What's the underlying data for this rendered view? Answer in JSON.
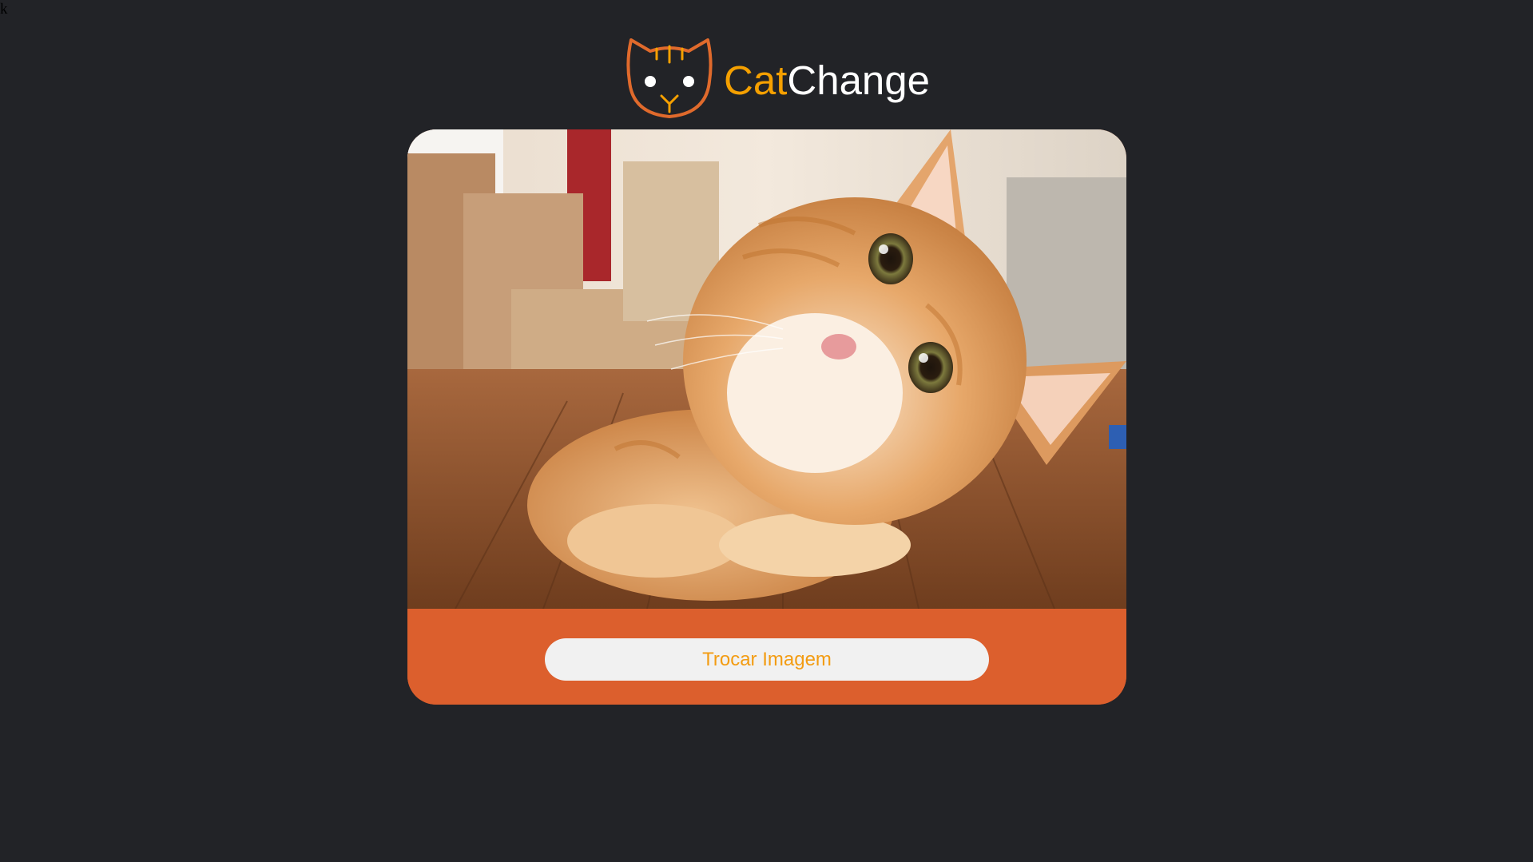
{
  "stray_text": "k",
  "brand": {
    "name_part1": "Cat",
    "name_part2": "Change",
    "icon": "cat-head-icon",
    "colors": {
      "accent_orange": "#f5a000",
      "outline_orange": "#e06a2c",
      "white": "#ffffff"
    }
  },
  "card": {
    "image": "orange-tabby-cat-photo",
    "button_label": "Trocar Imagem",
    "colors": {
      "footer_bg": "#dc5f2d",
      "button_bg": "#f1f1f1",
      "button_text": "#f39c12"
    }
  },
  "page": {
    "background": "#222327"
  }
}
